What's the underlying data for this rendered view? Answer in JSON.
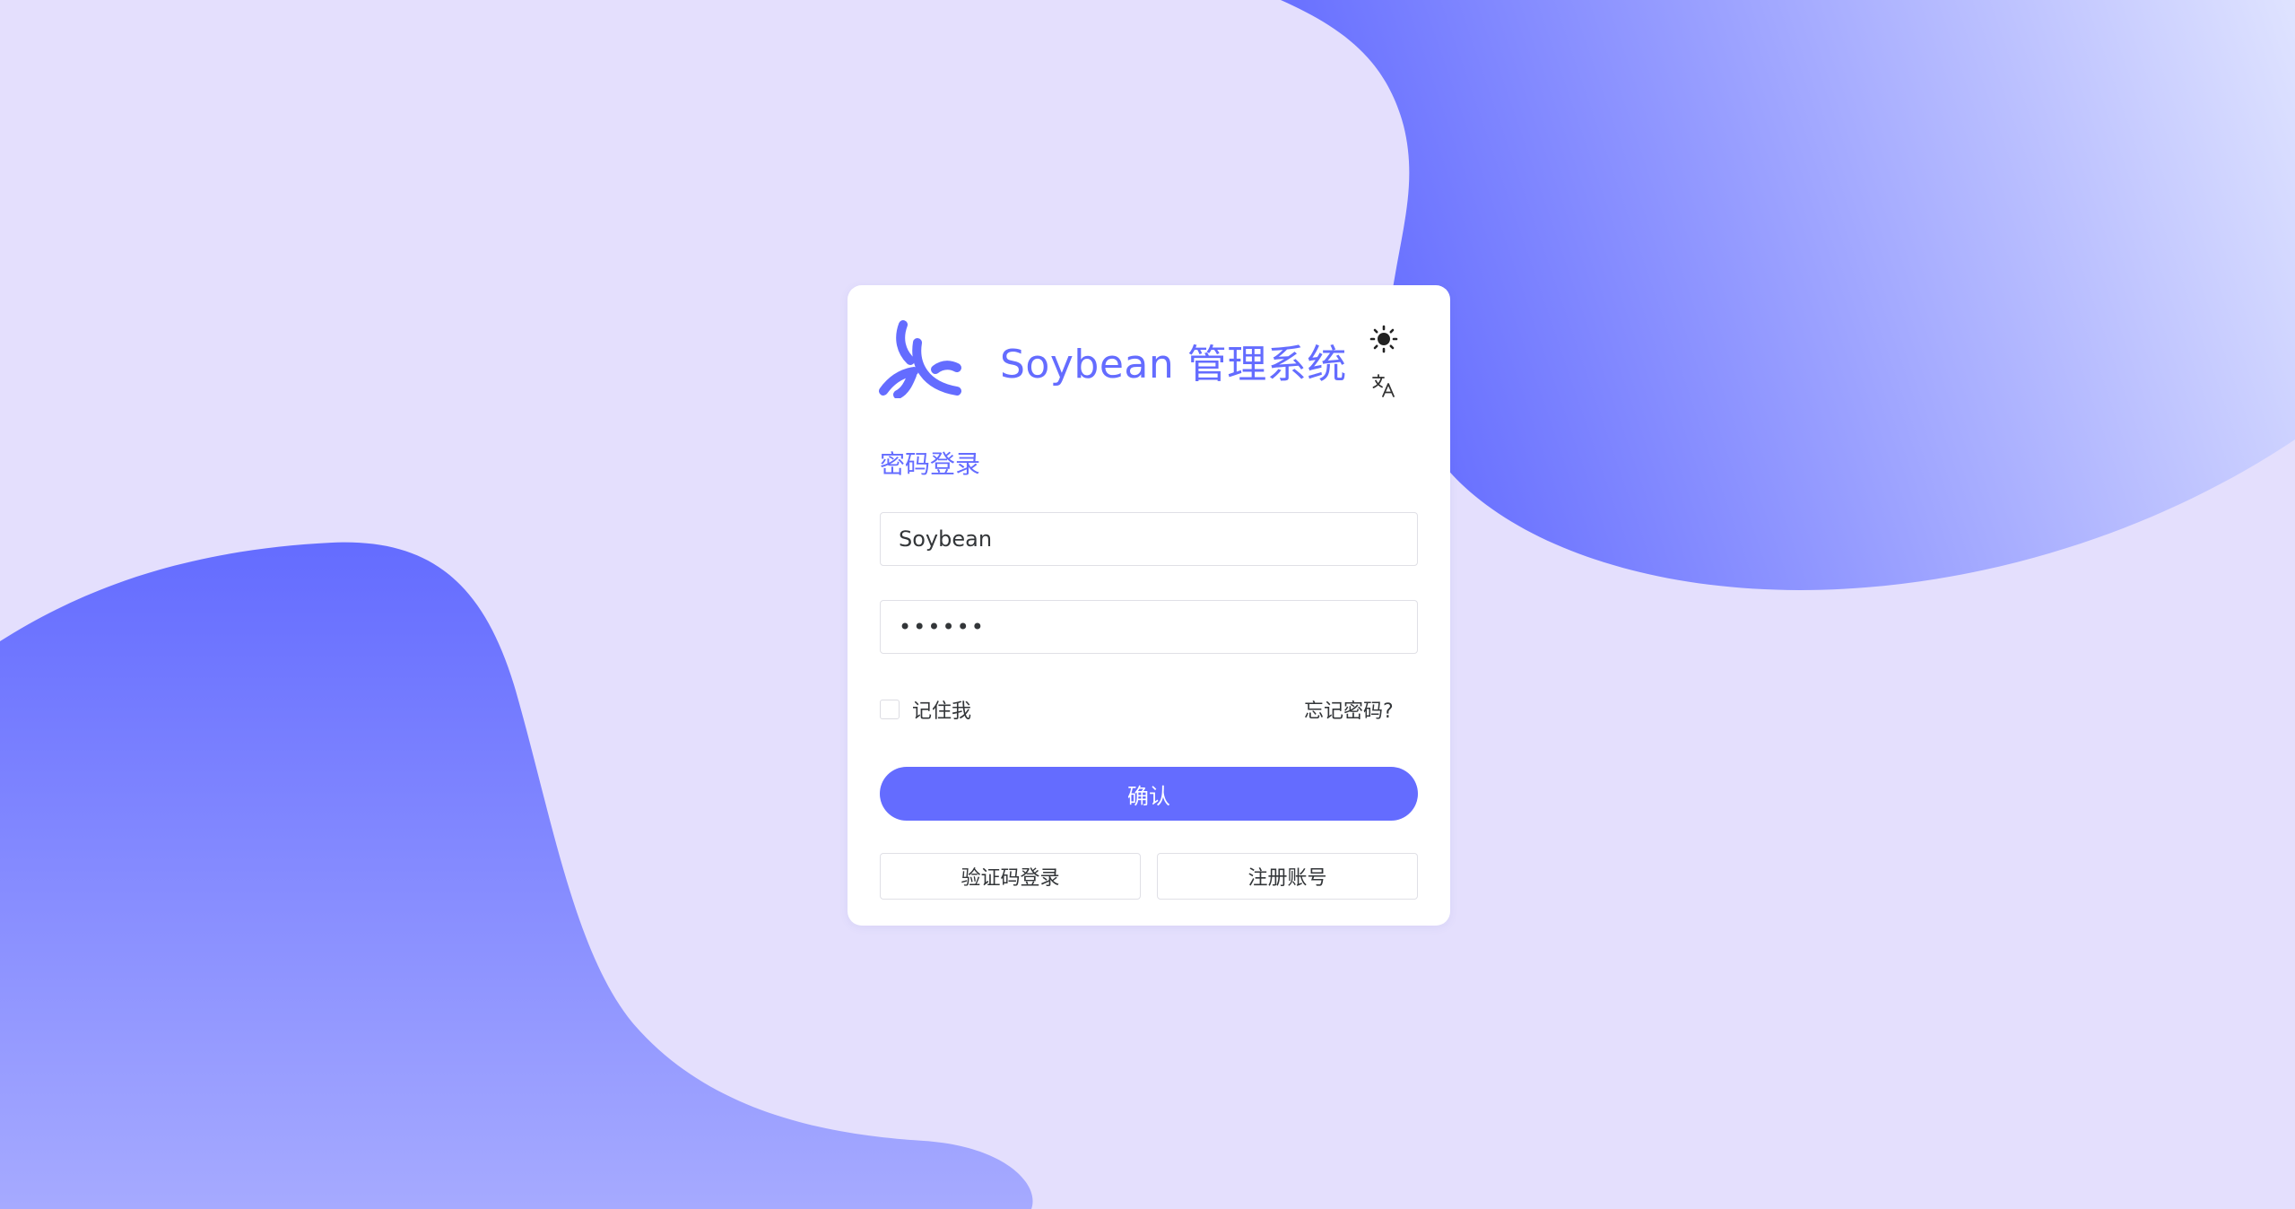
{
  "app": {
    "title": "Soybean 管理系统"
  },
  "colors": {
    "primary": "#646cff",
    "background": "#e4dffd",
    "blob_light": "#d4d8ff",
    "text": "#333639"
  },
  "header": {
    "theme_toggle_icon": "sun-icon",
    "language_icon": "translate-icon"
  },
  "login": {
    "mode_title": "密码登录",
    "username": {
      "value": "Soybean",
      "placeholder": ""
    },
    "password": {
      "value": "123456",
      "placeholder": ""
    },
    "remember_label": "记住我",
    "remember_checked": false,
    "forgot_label": "忘记密码?",
    "confirm_label": "确认",
    "code_login_label": "验证码登录",
    "register_label": "注册账号"
  }
}
